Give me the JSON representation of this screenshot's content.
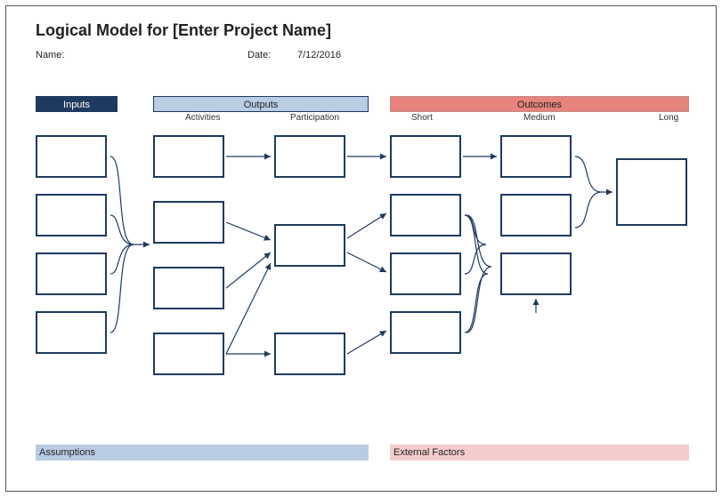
{
  "title": "Logical Model for [Enter Project Name]",
  "fields": {
    "name_label": "Name:",
    "name_value": "",
    "date_label": "Date:",
    "date_value": "7/12/2016"
  },
  "headers": {
    "inputs": "Inputs",
    "outputs": "Outputs",
    "outcomes": "Outcomes"
  },
  "subheaders": {
    "activities": "Activities",
    "participation": "Participation",
    "short": "Short",
    "medium": "Medium",
    "long": "Long"
  },
  "footers": {
    "assumptions": "Assumptions",
    "external_factors": "External Factors"
  },
  "colors": {
    "dark_blue": "#1f3a5f",
    "light_blue": "#b8cce4",
    "salmon": "#e6847d",
    "light_pink": "#f4cccc"
  }
}
